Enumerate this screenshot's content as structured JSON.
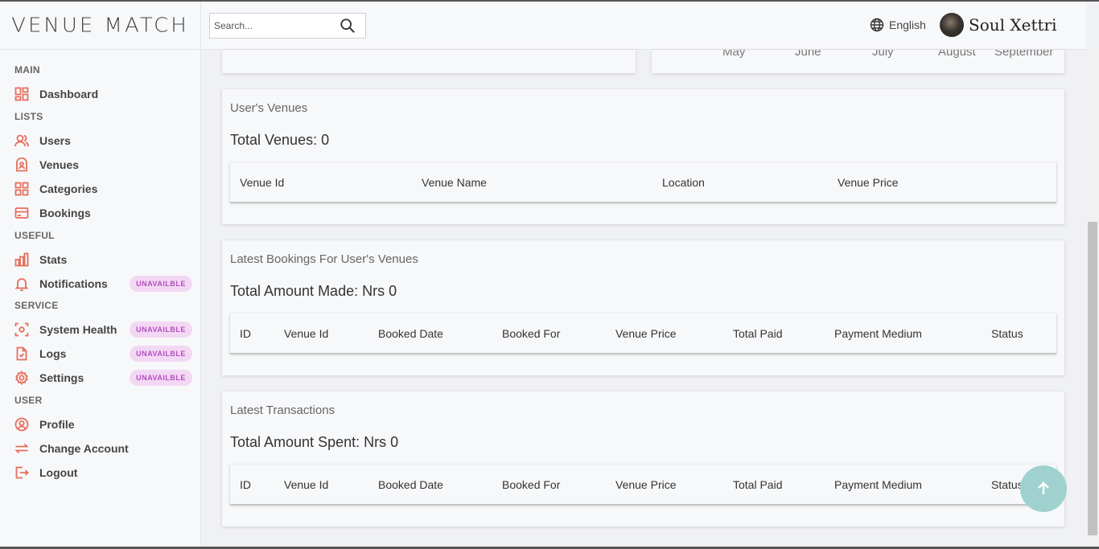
{
  "brand": {
    "logo_text": "VENUE MATCH"
  },
  "header": {
    "search_placeholder": "Search...",
    "language": "English",
    "user_name": "Soul Xettri"
  },
  "sidebar": {
    "sections": [
      {
        "title": "MAIN",
        "items": [
          {
            "label": "Dashboard",
            "icon": "dashboard-icon"
          }
        ]
      },
      {
        "title": "LISTS",
        "items": [
          {
            "label": "Users",
            "icon": "users-icon"
          },
          {
            "label": "Venues",
            "icon": "venue-icon"
          },
          {
            "label": "Categories",
            "icon": "categories-icon"
          },
          {
            "label": "Bookings",
            "icon": "bookings-icon"
          }
        ]
      },
      {
        "title": "USEFUL",
        "items": [
          {
            "label": "Stats",
            "icon": "stats-icon"
          },
          {
            "label": "Notifications",
            "icon": "bell-icon",
            "badge": "UNAVAILBLE"
          }
        ]
      },
      {
        "title": "SERVICE",
        "items": [
          {
            "label": "System Health",
            "icon": "health-icon",
            "badge": "UNAVAILBLE"
          },
          {
            "label": "Logs",
            "icon": "logs-icon",
            "badge": "UNAVAILBLE"
          },
          {
            "label": "Settings",
            "icon": "settings-icon",
            "badge": "UNAVAILBLE"
          }
        ]
      },
      {
        "title": "USER",
        "items": [
          {
            "label": "Profile",
            "icon": "profile-icon"
          },
          {
            "label": "Change Account",
            "icon": "swap-icon"
          },
          {
            "label": "Logout",
            "icon": "logout-icon"
          }
        ]
      }
    ]
  },
  "chart_partial": {
    "months": [
      "May",
      "June",
      "July",
      "August",
      "September"
    ]
  },
  "venues_card": {
    "title": "User's Venues",
    "total": "Total Venues: 0",
    "columns": [
      "Venue Id",
      "Venue Name",
      "Location",
      "Venue Price"
    ]
  },
  "bookings_card": {
    "title": "Latest Bookings For User's Venues",
    "total": "Total Amount Made: Nrs 0",
    "columns": [
      "ID",
      "Venue Id",
      "Booked Date",
      "Booked For",
      "Venue Price",
      "Total Paid",
      "Payment Medium",
      "Status"
    ]
  },
  "transactions_card": {
    "title": "Latest Transactions",
    "total": "Total Amount Spent: Nrs 0",
    "columns": [
      "ID",
      "Venue Id",
      "Booked Date",
      "Booked For",
      "Venue Price",
      "Total Paid",
      "Payment Medium",
      "Status"
    ]
  },
  "colors": {
    "accent": "#e66e5c",
    "badge_bg": "#f3d8f4",
    "badge_text": "#b34ec0",
    "fab": "#9fd2ce"
  }
}
